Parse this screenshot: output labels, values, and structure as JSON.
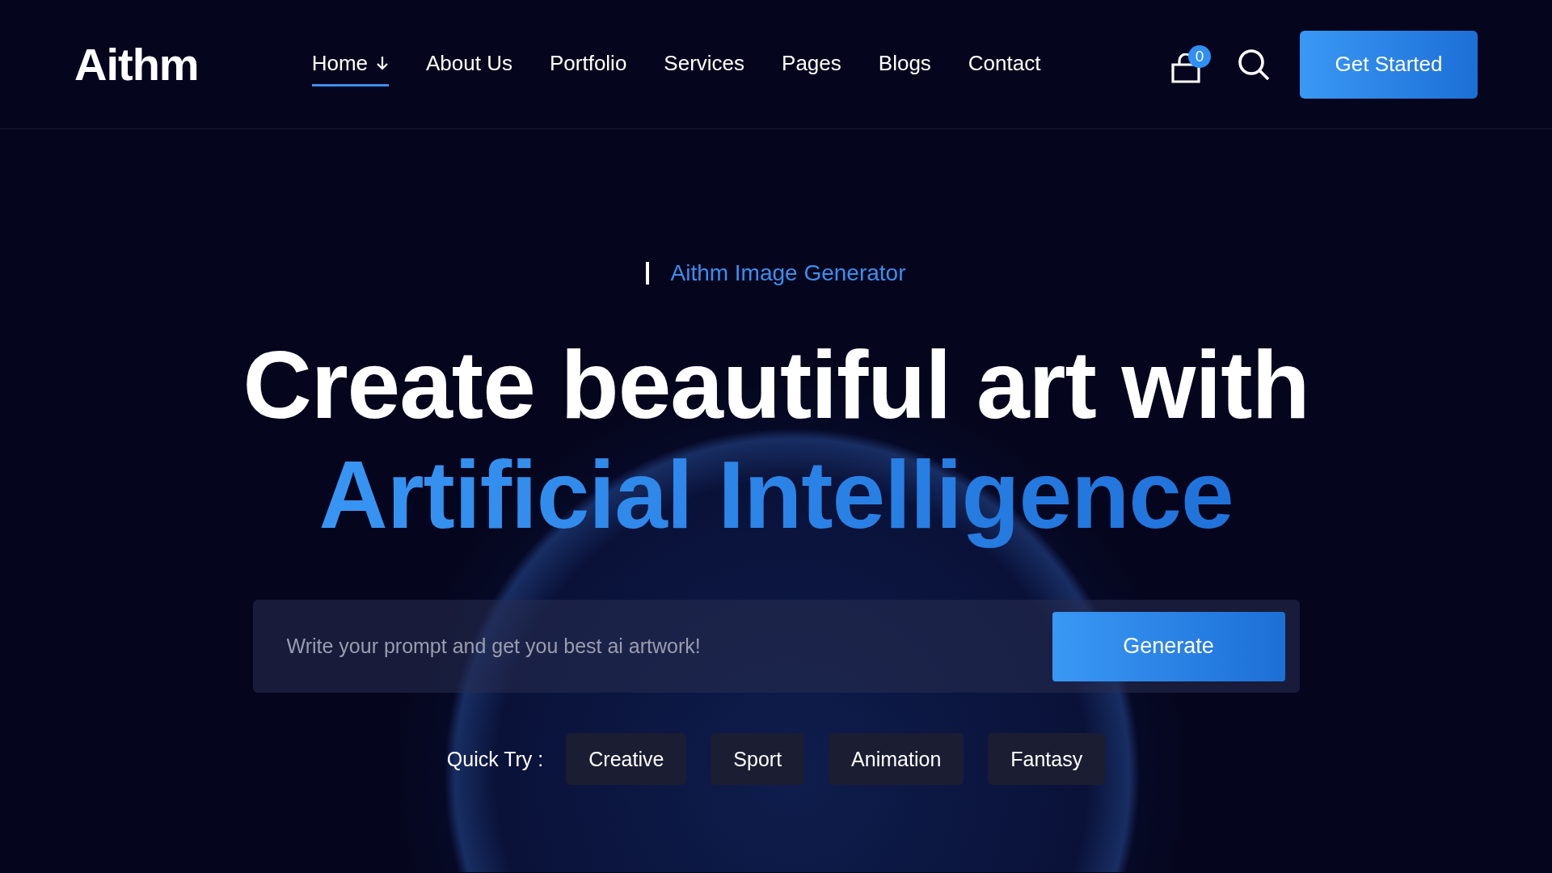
{
  "header": {
    "logo": "Aithm",
    "nav": [
      {
        "label": "Home",
        "selected": true,
        "dropdown": true
      },
      {
        "label": "About Us",
        "selected": false,
        "dropdown": false
      },
      {
        "label": "Portfolio",
        "selected": false,
        "dropdown": false
      },
      {
        "label": "Services",
        "selected": false,
        "dropdown": false
      },
      {
        "label": "Pages",
        "selected": false,
        "dropdown": false
      },
      {
        "label": "Blogs",
        "selected": false,
        "dropdown": false
      },
      {
        "label": "Contact",
        "selected": false,
        "dropdown": false
      }
    ],
    "cart_count": "0",
    "cta": "Get Started"
  },
  "hero": {
    "eyebrow": "Aithm Image Generator",
    "headline": "Create beautiful art with",
    "headline_accent": "Artificial Intelligence",
    "prompt": {
      "placeholder": "Write your prompt and get you best ai artwork!",
      "button": "Generate"
    },
    "quick_try": {
      "label": "Quick Try :",
      "chips": [
        "Creative",
        "Sport",
        "Animation",
        "Fantasy"
      ]
    }
  }
}
